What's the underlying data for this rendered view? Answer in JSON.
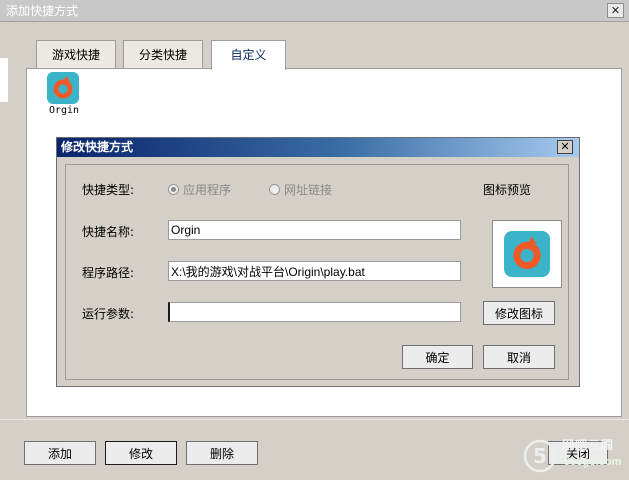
{
  "window": {
    "title": "添加快捷方式",
    "close_glyph": "✕"
  },
  "tabs": [
    {
      "label": "游戏快捷",
      "active": false
    },
    {
      "label": "分类快捷",
      "active": false
    },
    {
      "label": "自定义",
      "active": true
    }
  ],
  "shortcut": {
    "label": "Orgin",
    "icon": "origin-icon",
    "icon_color": "#3bb3c9",
    "logo_color": "#f05a28"
  },
  "dialog": {
    "title": "修改快捷方式",
    "close_glyph": "✕",
    "type_label": "快捷类型:",
    "type_options": [
      {
        "label": "应用程序",
        "selected": true
      },
      {
        "label": "网址链接",
        "selected": false
      }
    ],
    "name_label": "快捷名称:",
    "name_value": "Orgin",
    "path_label": "程序路径:",
    "path_value": "X:\\我的游戏\\对战平台\\Origin\\play.bat",
    "args_label": "运行参数:",
    "args_value": "",
    "preview_label": "图标预览",
    "change_icon_label": "修改图标",
    "ok_label": "确定",
    "cancel_label": "取消",
    "title_gradient": [
      "#0a246a",
      "#a6caf0"
    ]
  },
  "bottom": {
    "add_label": "添加",
    "modify_label": "修改",
    "delete_label": "删除",
    "close_label": "关闭"
  },
  "watermark": {
    "line1": "网吧三国",
    "line2": "583go.com"
  }
}
